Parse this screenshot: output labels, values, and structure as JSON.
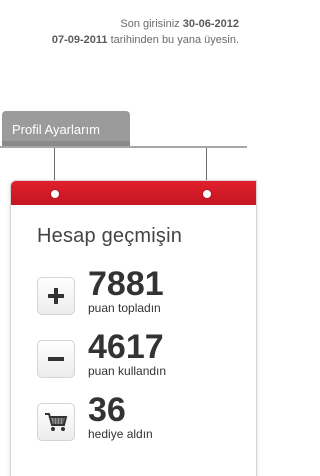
{
  "login": {
    "line1_prefix": "Son girisiniz ",
    "last_login_date": "30-06-2012",
    "member_since_date": "07-09-2011",
    "line2_suffix": " tarihinden bu yana üyesin."
  },
  "profile_tab": {
    "label": "Profil Ayarlarım"
  },
  "history_card": {
    "title": "Hesap geçmişin",
    "stats": [
      {
        "value": "7881",
        "label": "puan topladın",
        "icon": "plus-icon"
      },
      {
        "value": "4617",
        "label": "puan kullandın",
        "icon": "minus-icon"
      },
      {
        "value": "36",
        "label": "hediye aldın",
        "icon": "cart-icon"
      }
    ]
  },
  "colors": {
    "accent_red": "#d91c28",
    "tab_gray": "#9b9b9b",
    "text_dark": "#333333"
  }
}
